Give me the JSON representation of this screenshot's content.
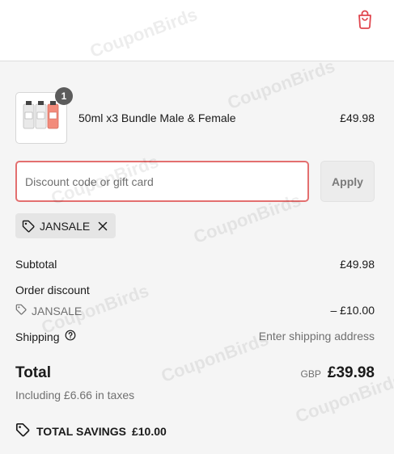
{
  "header": {
    "bag_icon": "shopping-bag-icon",
    "accent_color": "#e0464e"
  },
  "line_item": {
    "quantity": "1",
    "title": "50ml x3 Bundle Male & Female",
    "price": "£49.98"
  },
  "discount": {
    "placeholder": "Discount code or gift card",
    "value": "",
    "apply_label": "Apply",
    "applied_code": "JANSALE"
  },
  "summary": {
    "subtotal_label": "Subtotal",
    "subtotal_value": "£49.98",
    "order_discount_label": "Order discount",
    "discount_code": "JANSALE",
    "discount_value": "– £10.00",
    "shipping_label": "Shipping",
    "shipping_value": "Enter shipping address",
    "total_label": "Total",
    "currency": "GBP",
    "total_value": "£39.98",
    "taxes_note": "Including £6.66 in taxes",
    "savings_label": "TOTAL SAVINGS",
    "savings_value": "£10.00"
  },
  "watermark": "CouponBirds"
}
